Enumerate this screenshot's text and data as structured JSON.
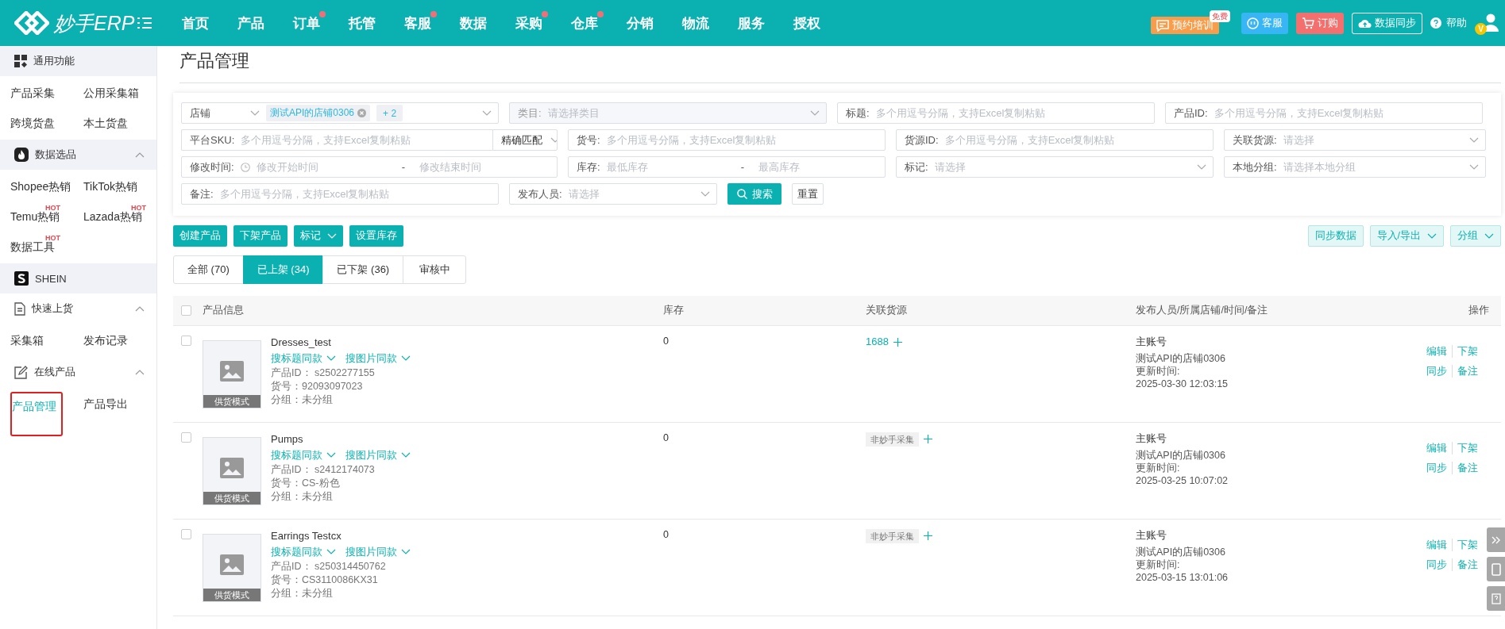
{
  "header": {
    "logo": "妙手ERP",
    "nav": [
      {
        "label": "首页",
        "badge": false
      },
      {
        "label": "产品",
        "badge": false
      },
      {
        "label": "订单",
        "badge": true
      },
      {
        "label": "托管",
        "badge": false
      },
      {
        "label": "客服",
        "badge": true
      },
      {
        "label": "数据",
        "badge": false
      },
      {
        "label": "采购",
        "badge": true
      },
      {
        "label": "仓库",
        "badge": true
      },
      {
        "label": "分销",
        "badge": false
      },
      {
        "label": "物流",
        "badge": false
      },
      {
        "label": "服务",
        "badge": false
      },
      {
        "label": "授权",
        "badge": false
      }
    ],
    "actions": [
      {
        "kind": "training",
        "label": "预约培训",
        "badge": "免费"
      },
      {
        "kind": "service",
        "label": "客服"
      },
      {
        "kind": "order",
        "label": "订购"
      },
      {
        "kind": "sync",
        "label": "数据同步"
      },
      {
        "kind": "help",
        "label": "帮助"
      }
    ],
    "avatar_badge": "V"
  },
  "sidebar": {
    "sections": [
      {
        "kind": "grid",
        "label": "通用功能",
        "shaded": true,
        "items": [
          {
            "label": "产品采集",
            "selected": false
          },
          {
            "label": "公用采集箱",
            "selected": false
          },
          {
            "label": "跨境货盘",
            "selected": false
          },
          {
            "label": "本土货盘",
            "selected": false
          }
        ]
      },
      {
        "kind": "fire",
        "label": "数据选品",
        "shaded": true,
        "expanded": true,
        "items": [
          {
            "label": "Shopee热销",
            "selected": false
          },
          {
            "label": "TikTok热销",
            "selected": false
          },
          {
            "label": "Temu热销",
            "selected": false,
            "hot": "HOT"
          },
          {
            "label": "Lazada热销",
            "selected": false,
            "hot": "HOT"
          },
          {
            "label": "数据工具",
            "selected": false,
            "hot": "HOT"
          }
        ]
      },
      {
        "kind": "brand",
        "label": "SHEIN",
        "shaded": true
      },
      {
        "kind": "document",
        "label": "快速上货",
        "shaded": false,
        "expanded": true,
        "items": [
          {
            "label": "采集箱",
            "selected": false
          },
          {
            "label": "发布记录",
            "selected": false
          }
        ]
      },
      {
        "kind": "edit",
        "label": "在线产品",
        "shaded": false,
        "expanded": true,
        "items": [
          {
            "label": "产品管理",
            "selected": true,
            "outlined": true
          },
          {
            "label": "产品导出",
            "selected": false
          }
        ]
      }
    ]
  },
  "page_title": "产品管理",
  "filters": [
    {
      "fields": [
        {
          "kind": "multiselect",
          "label": "店铺",
          "tags": [
            "测试API的店铺0306"
          ],
          "more": "+ 2"
        },
        {
          "kind": "select",
          "label": "类目:",
          "placeholder": "请选择类目",
          "disabled": true
        },
        {
          "kind": "input",
          "label": "标题:",
          "placeholder": "多个用逗号分隔，支持Excel复制粘贴"
        },
        {
          "kind": "input",
          "label": "产品ID:",
          "placeholder": "多个用逗号分隔，支持Excel复制粘贴"
        }
      ]
    },
    {
      "fields": [
        {
          "kind": "input-match",
          "label": "平台SKU:",
          "placeholder": "多个用逗号分隔，支持Excel复制粘贴",
          "mode": "精确匹配"
        },
        {
          "kind": "input",
          "label": "货号:",
          "placeholder": "多个用逗号分隔，支持Excel复制粘贴"
        },
        {
          "kind": "input",
          "label": "货源ID:",
          "placeholder": "多个用逗号分隔，支持Excel复制粘贴"
        },
        {
          "kind": "select",
          "label": "关联货源:",
          "placeholder": "请选择",
          "disabled": false
        }
      ]
    },
    {
      "fields": [
        {
          "kind": "date-range",
          "label": "修改时间:",
          "from": "修改开始时间",
          "separator": "-",
          "to": "修改结束时间"
        },
        {
          "kind": "range",
          "label": "库存:",
          "from": "最低库存",
          "separator": "-",
          "to": "最高库存"
        },
        {
          "kind": "select",
          "label": "标记:",
          "placeholder": "请选择",
          "disabled": false
        },
        {
          "kind": "select",
          "label": "本地分组:",
          "placeholder": "请选择本地分组",
          "disabled": false
        }
      ]
    },
    {
      "fields": [
        {
          "kind": "input",
          "label": "备注:",
          "placeholder": "多个用逗号分隔，支持Excel复制粘贴"
        },
        {
          "kind": "select",
          "label": "发布人员:",
          "placeholder": "请选择",
          "disabled": false
        },
        {
          "kind": "primary-button",
          "label": "搜索"
        },
        {
          "kind": "button",
          "label": "重置"
        }
      ]
    }
  ],
  "toolbar": {
    "left": [
      {
        "label": "创建产品",
        "dropdown": false
      },
      {
        "label": "下架产品",
        "dropdown": false
      },
      {
        "label": "标记",
        "dropdown": true
      },
      {
        "label": "设置库存",
        "dropdown": false
      }
    ],
    "right": [
      {
        "label": "同步数据",
        "dropdown": false
      },
      {
        "label": "导入/导出",
        "dropdown": true
      },
      {
        "label": "分组",
        "dropdown": true
      }
    ]
  },
  "tabs": [
    {
      "label": "全部 (70)",
      "selected": false
    },
    {
      "label": "已上架 (34)",
      "selected": true
    },
    {
      "label": "已下架 (36)",
      "selected": false
    },
    {
      "label": "审核中",
      "selected": false
    }
  ],
  "table": {
    "header_checked": false,
    "columns": [
      "产品信息",
      "库存",
      "关联货源",
      "发布人员/所属店铺/时间/备注",
      "操作"
    ],
    "rows": [
      {
        "checked": false,
        "title": "Dresses_test",
        "search_links": [
          "搜标题同款",
          "搜图片同款"
        ],
        "mode_label": "供货模式",
        "details": [
          "产品ID： s2502277155",
          "货号：92093097023",
          "分组：未分组"
        ],
        "stock": "0",
        "source": {
          "kind": "link",
          "label": "1688"
        },
        "publisher": "主账号",
        "store": "测试API的店铺0306",
        "updated_label": "更新时间:",
        "updated": "2025-03-30 12:03:15",
        "actions": [
          "编辑",
          "下架",
          "同步",
          "备注"
        ]
      },
      {
        "checked": false,
        "title": "Pumps",
        "search_links": [
          "搜标题同款",
          "搜图片同款"
        ],
        "mode_label": "供货模式",
        "details": [
          "产品ID： s2412174073",
          "货号：CS-粉色",
          "分组：未分组"
        ],
        "stock": "0",
        "source": {
          "kind": "tag",
          "label": "非妙手采集"
        },
        "publisher": "主账号",
        "store": "测试API的店铺0306",
        "updated_label": "更新时间:",
        "updated": "2025-03-25 10:07:02",
        "actions": [
          "编辑",
          "下架",
          "同步",
          "备注"
        ]
      },
      {
        "checked": false,
        "title": "Earrings Testcx",
        "search_links": [
          "搜标题同款",
          "搜图片同款"
        ],
        "mode_label": "供货模式",
        "details": [
          "产品ID： s250314450762",
          "货号：CS3110086KX31",
          "分组：未分组"
        ],
        "stock": "0",
        "source": {
          "kind": "tag",
          "label": "非妙手采集"
        },
        "publisher": "主账号",
        "store": "测试API的店铺0306",
        "updated_label": "更新时间:",
        "updated": "2025-03-15 13:01:06",
        "actions": [
          "编辑",
          "下架",
          "同步",
          "备注"
        ]
      }
    ]
  }
}
